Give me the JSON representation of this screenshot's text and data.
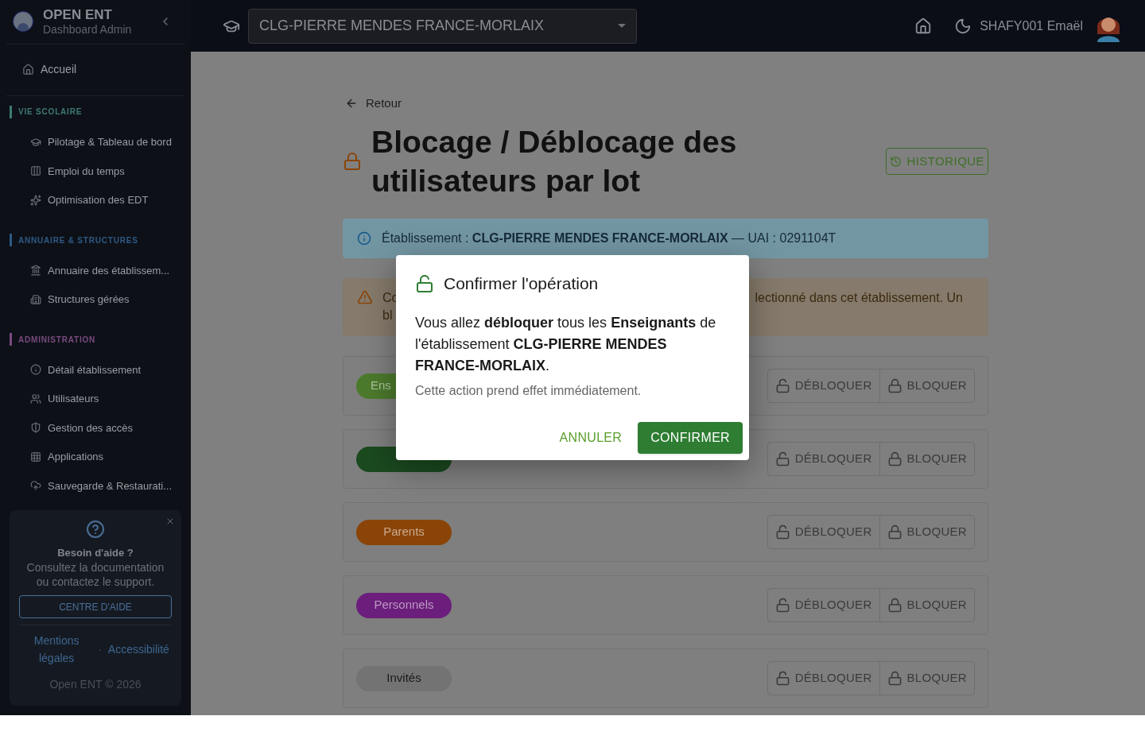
{
  "sidebar": {
    "brand": {
      "title": "OPEN ENT",
      "subtitle": "Dashboard Admin"
    },
    "home": {
      "label": "Accueil"
    },
    "sections": [
      {
        "heading": "VIE SCOLAIRE",
        "color": "#3d7a74",
        "items": [
          {
            "label": "Pilotage & Tableau de bord"
          },
          {
            "label": "Emploi du temps"
          },
          {
            "label": "Optimisation des EDT"
          }
        ]
      },
      {
        "heading": "ANNUAIRE & STRUCTURES",
        "color": "#2e5a85",
        "items": [
          {
            "label": "Annuaire des établissem..."
          },
          {
            "label": "Structures gérées"
          }
        ]
      },
      {
        "heading": "ADMINISTRATION",
        "color": "#7a4a80",
        "items": [
          {
            "label": "Détail établissement"
          },
          {
            "label": "Utilisateurs"
          },
          {
            "label": "Gestion des accès"
          },
          {
            "label": "Applications"
          },
          {
            "label": "Sauvegarde & Restaurati..."
          }
        ]
      }
    ],
    "help": {
      "title": "Besoin d'aide ?",
      "text": "Consultez la documentation ou contactez le support.",
      "button": "CENTRE D'AIDE",
      "links": [
        "Mentions légales",
        "Accessibilité"
      ],
      "separator": "·",
      "footer": "Open ENT © 2026"
    }
  },
  "topbar": {
    "school_select": "CLG-PIERRE MENDES FRANCE-MORLAIX",
    "user": "SHAFY001 Emaël"
  },
  "page": {
    "back": "Retour",
    "title": "Blocage / Déblocage des utilisateurs par lot",
    "history_button": "HISTORIQUE",
    "info": "Établissement : **CLG-PIERRE MENDES FRANCE-MORLAIX** — UAI : 0291104T",
    "warning": {
      "left_lines": [
        "Co",
        "bl"
      ],
      "right_text": "lectionné dans cet établissement. Un"
    },
    "groups": [
      {
        "label": "Ens",
        "color": "#4c7a2c",
        "actions": [
          "DÉBLOQUER",
          "BLOQUER"
        ]
      },
      {
        "color": "#1b4a1f",
        "actions": [
          "DÉBLOQUER",
          "BLOQUER"
        ]
      },
      {
        "label": "Parents",
        "color": "#8a4408",
        "actions": [
          "DÉBLOQUER",
          "BLOQUER"
        ]
      },
      {
        "label": "Personnels",
        "color": "#6b1e7b",
        "actions": [
          "DÉBLOQUER",
          "BLOQUER"
        ]
      },
      {
        "label": "Invités",
        "color": "#737373",
        "actions": [
          "DÉBLOQUER",
          "BLOQUER"
        ]
      }
    ]
  },
  "dialog": {
    "title": "Confirmer l'opération",
    "message": "Vous allez **débloquer** tous les **Enseignants** de l'établissement **CLG-PIERRE MENDES FRANCE-MORLAIX**.",
    "note": "Cette action prend effet immédiatement.",
    "cancel": "ANNULER",
    "confirm": "CONFIRMER"
  }
}
